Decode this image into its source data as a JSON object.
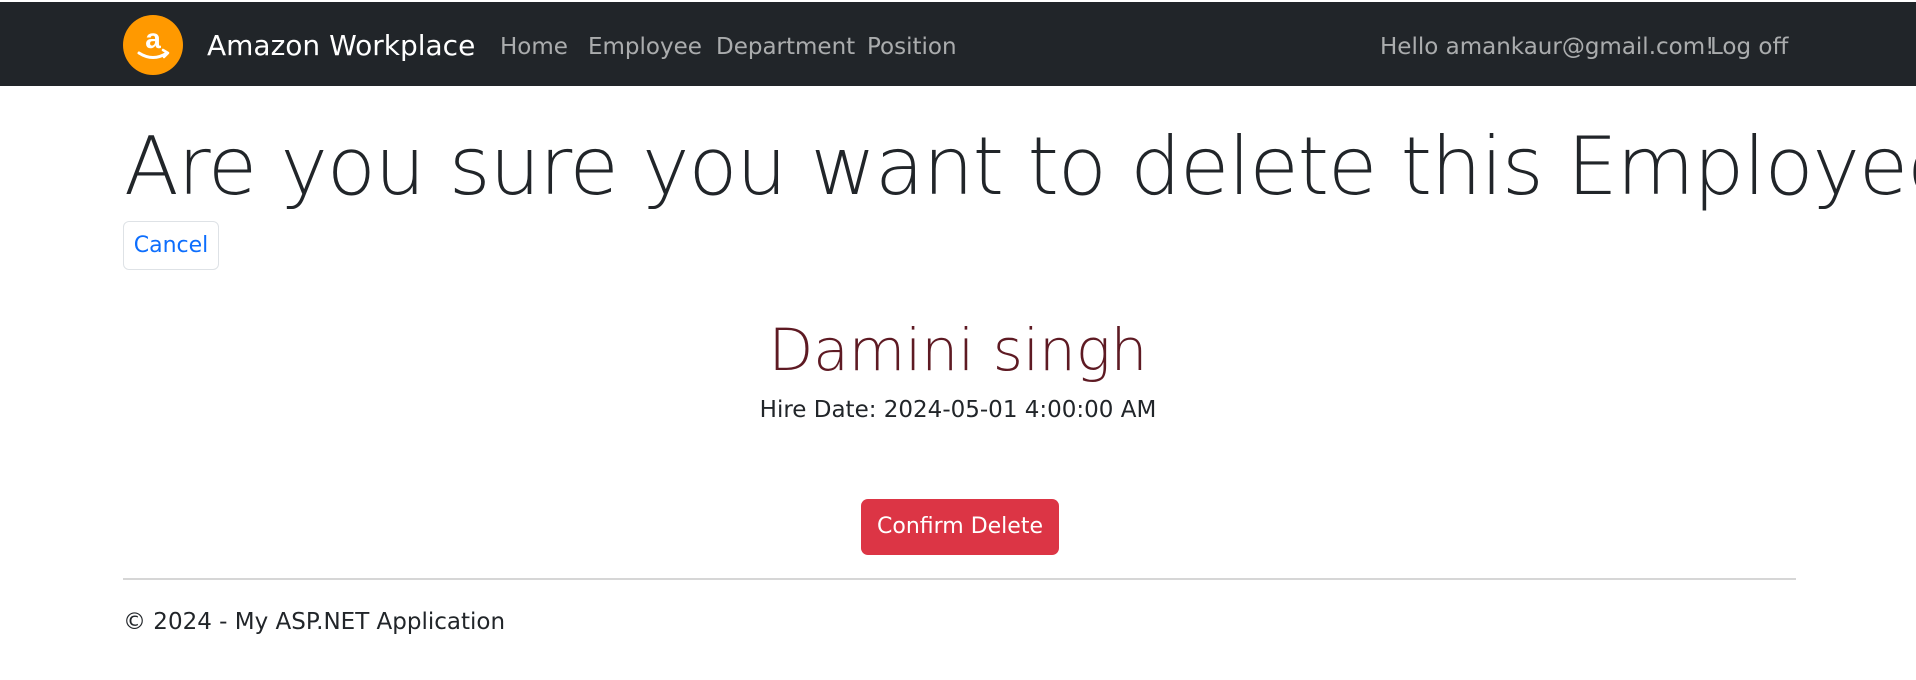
{
  "navbar": {
    "brand": "Amazon Workplace",
    "logo_letter": "a",
    "logo_color": "#ff9900",
    "links": [
      {
        "label": "Home"
      },
      {
        "label": "Employee"
      },
      {
        "label": "Department"
      },
      {
        "label": "Position"
      }
    ],
    "greeting": "Hello amankaur@gmail.com!",
    "logoff": "Log off"
  },
  "main": {
    "heading": "Are you sure you want to delete this Employee?",
    "cancel_label": "Cancel",
    "employee_name": "Damini singh",
    "hire_date": "Hire Date: 2024-05-01 4:00:00 AM",
    "confirm_label": "Confirm Delete",
    "confirm_color": "#dc3545",
    "name_color": "#5e1a23"
  },
  "footer": {
    "text": "© 2024 - My ASP.NET Application"
  }
}
